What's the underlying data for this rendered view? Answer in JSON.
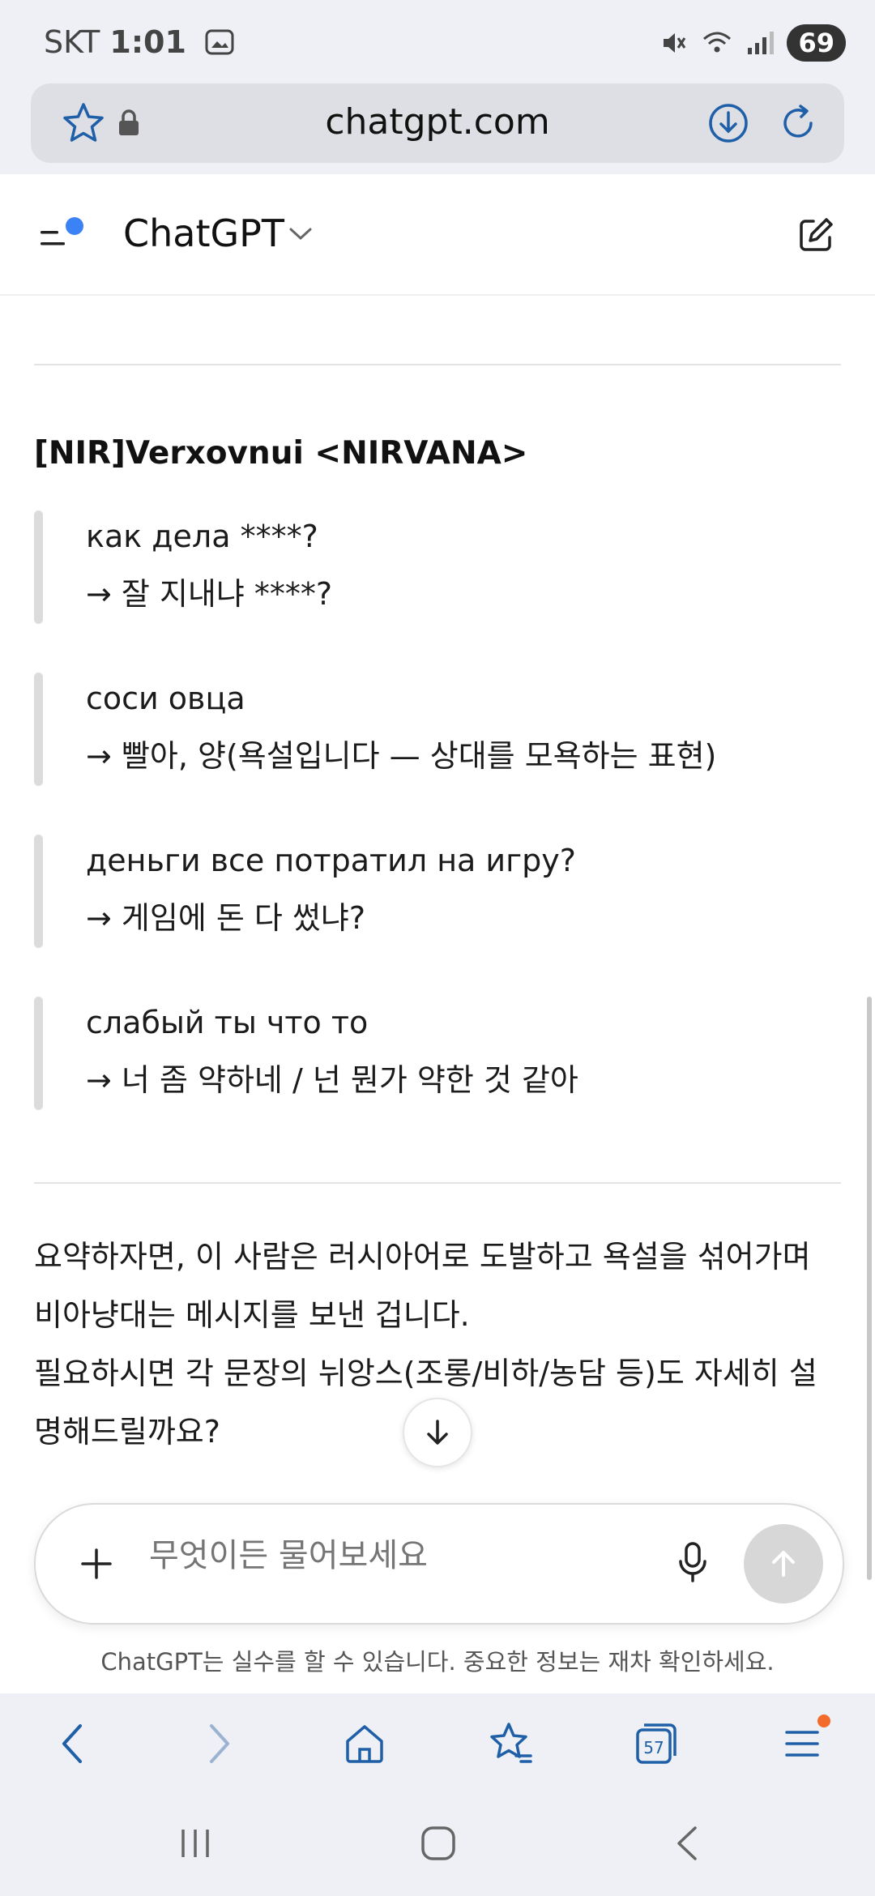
{
  "status_bar": {
    "carrier": "SKT",
    "time": "1:01",
    "battery": "69"
  },
  "browser": {
    "url": "chatgpt.com"
  },
  "chat_header": {
    "title": "ChatGPT"
  },
  "conversation": {
    "section_title": "[NIR]Verxovnui <NIRVANA>",
    "quotes": [
      {
        "original": "как дела ****?",
        "translation": "→ 잘 지내냐 ****?"
      },
      {
        "original": "соси овца",
        "translation": "→ 빨아, 양(욕설입니다 — 상대를 모욕하는 표현)"
      },
      {
        "original": "деньги все потратил на игру?",
        "translation": "→ 게임에 돈 다 썼냐?"
      },
      {
        "original": "слабый ты что то",
        "translation": "→ 너 좀 약하네 / 넌 뭔가 약한 것 같아"
      }
    ],
    "summary_lines": [
      "요약하자면, 이 사람은 러시아어로 도발하고 욕설을 섞어가며",
      "비아냥대는 메시지를 보낸 겁니다.",
      "필요하시면 각 문장의 뉘앙스(조롱/비하/농담 등)도 자세히 설",
      "명해드릴까요?"
    ]
  },
  "composer": {
    "placeholder": "무엇이든 물어보세요"
  },
  "disclaimer": "ChatGPT는 실수를 할 수 있습니다. 중요한 정보는 재차 확인하세요.",
  "bottom_nav": {
    "tabs_count": "57"
  },
  "colors": {
    "browser_accent": "#1f5fa8",
    "notification_dot": "#f26b2b",
    "menu_dot": "#3b82f6"
  }
}
